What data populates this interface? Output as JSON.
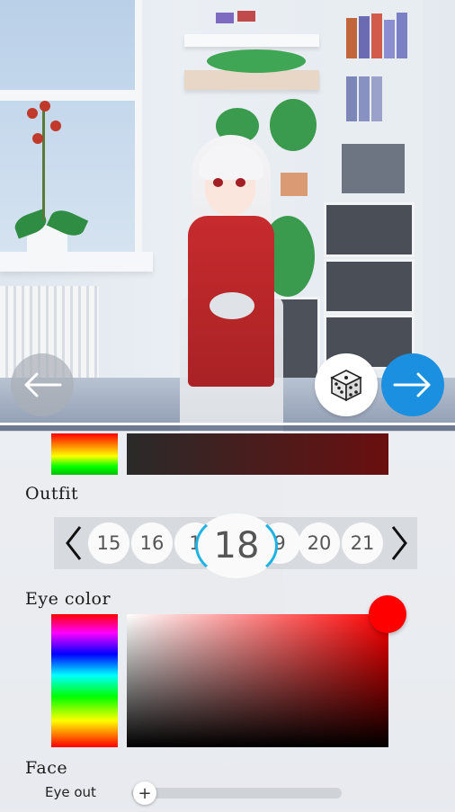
{
  "navigation": {
    "back_icon": "arrow-left-icon",
    "random_icon": "dice-icon",
    "next_icon": "arrow-right-icon"
  },
  "outfit": {
    "label": "Outfit",
    "numbers": [
      "15",
      "16",
      "1",
      "18",
      "9",
      "20",
      "21"
    ],
    "selected": "18",
    "prev_icon": "chevron-left-icon",
    "next_icon": "chevron-right-icon"
  },
  "eye_color": {
    "label": "Eye color",
    "selected_color": "#ff0000"
  },
  "face": {
    "label": "Face",
    "eye_out_label": "Eye out",
    "slider_value": 0
  },
  "colors": {
    "accent_blue": "#1b8fe0",
    "selection_ring": "#1fb3e4"
  }
}
